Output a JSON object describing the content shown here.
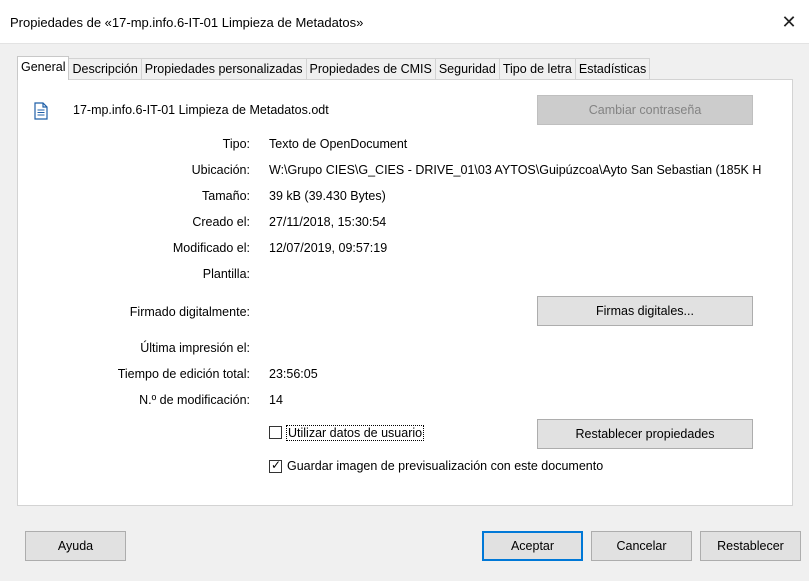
{
  "window": {
    "title": "Propiedades de «17-mp.info.6-IT-01 Limpieza de Metadatos»",
    "close_glyph": "✕"
  },
  "tabs": [
    {
      "label": "General",
      "active": true
    },
    {
      "label": "Descripción",
      "active": false
    },
    {
      "label": "Propiedades personalizadas",
      "active": false
    },
    {
      "label": "Propiedades de CMIS",
      "active": false
    },
    {
      "label": "Seguridad",
      "active": false
    },
    {
      "label": "Tipo de letra",
      "active": false
    },
    {
      "label": "Estadísticas",
      "active": false
    }
  ],
  "file": {
    "icon": "document-icon",
    "name": "17-mp.info.6-IT-01 Limpieza de Metadatos.odt",
    "change_password_label": "Cambiar contraseña"
  },
  "fields": {
    "type_label": "Tipo:",
    "type_value": "Texto de OpenDocument",
    "location_label": "Ubicación:",
    "location_value": "W:\\Grupo CIES\\G_CIES - DRIVE_01\\03 AYTOS\\Guipúzcoa\\Ayto San Sebastian (185K H",
    "size_label": "Tamaño:",
    "size_value": "39 kB (39.430 Bytes)",
    "created_label": "Creado el:",
    "created_value": "27/11/2018, 15:30:54",
    "modified_label": "Modificado el:",
    "modified_value": "12/07/2019, 09:57:19",
    "template_label": "Plantilla:",
    "signed_label": "Firmado digitalmente:",
    "signatures_button": "Firmas digitales...",
    "last_print_label": "Última impresión el:",
    "edit_time_label": "Tiempo de edición total:",
    "edit_time_value": "23:56:05",
    "revision_label": "N.º de modificación:",
    "revision_value": "14"
  },
  "options": {
    "use_user_data_label": "Utilizar datos de usuario",
    "use_user_data_checked": false,
    "reset_properties_button": "Restablecer propiedades",
    "save_preview_label": "Guardar imagen de previsualización con este documento",
    "save_preview_checked": true
  },
  "footer": {
    "help": "Ayuda",
    "ok": "Aceptar",
    "cancel": "Cancelar",
    "reset": "Restablecer"
  },
  "colors": {
    "accent": "#0078d7",
    "panel_bg": "#ffffff",
    "dialog_bg": "#f0f0f0"
  }
}
